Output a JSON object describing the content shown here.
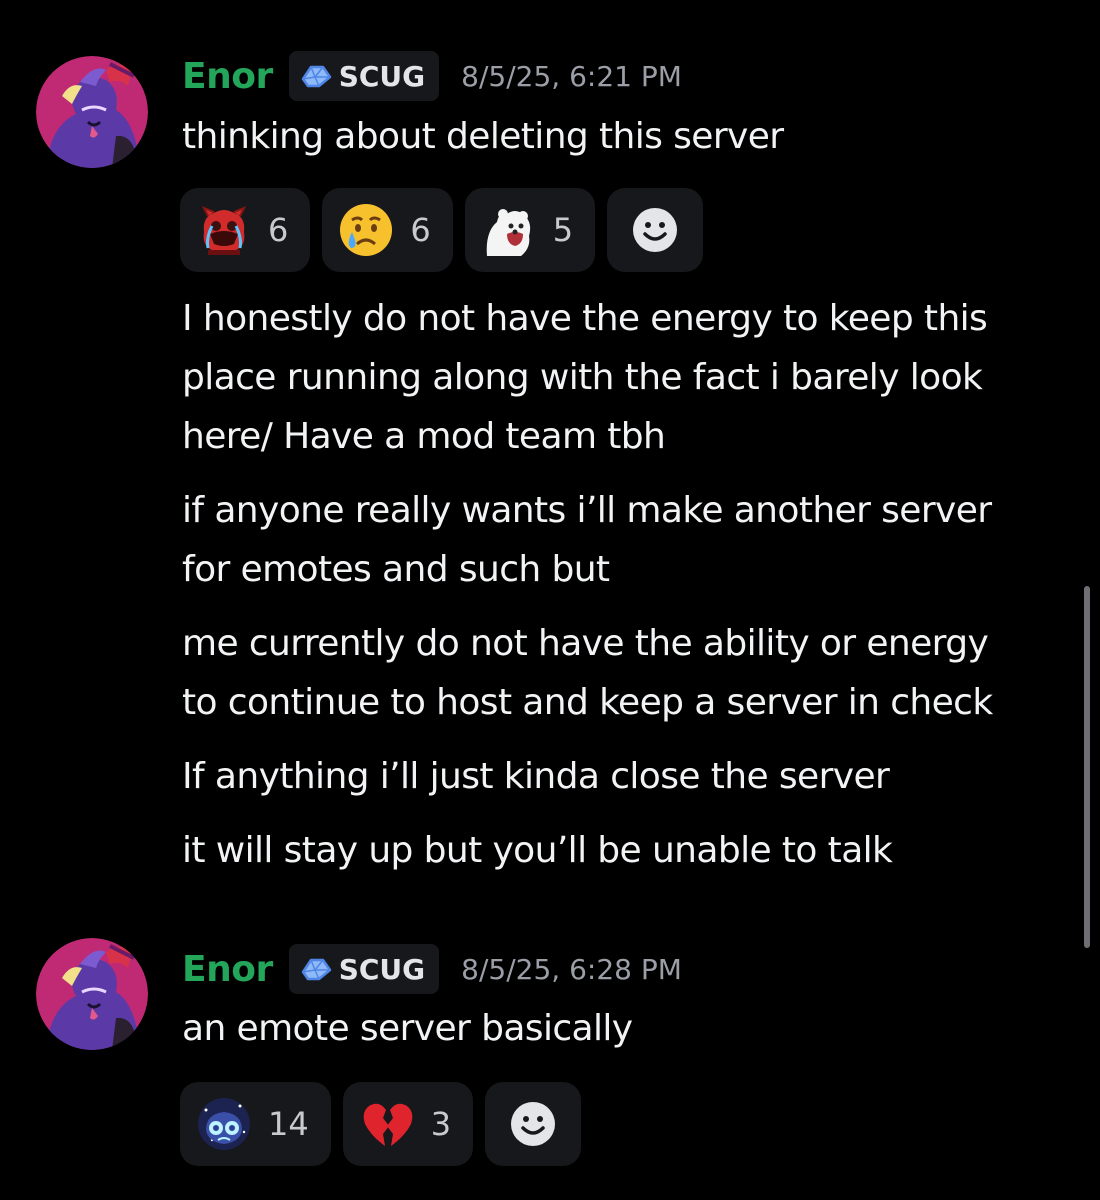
{
  "messages": [
    {
      "username": "Enor",
      "tag": "SCUG",
      "timestamp": "8/5/25, 6:21 PM",
      "lines": [
        "thinking about deleting this server"
      ],
      "reactions": [
        {
          "icon": "red-crying-creature-emoji",
          "count": "6"
        },
        {
          "icon": "crying-face-emoji",
          "count": "6"
        },
        {
          "icon": "white-bear-emoji",
          "count": "5"
        }
      ]
    },
    {
      "lines": [
        "I honestly do not have the energy to keep this",
        "place running along with the fact i barely look",
        "here/ Have a mod team tbh",
        "if anyone really wants i’ll make another server",
        "for emotes and such but",
        "me currently do not have the ability or energy",
        "to continue to host and keep a server in check",
        "If anything i’ll just kinda close the server",
        "it will stay up but you’ll be unable to talk"
      ]
    },
    {
      "username": "Enor",
      "tag": "SCUG",
      "timestamp": "8/5/25, 6:28 PM",
      "lines": [
        "an emote server basically"
      ],
      "reactions": [
        {
          "icon": "starry-crying-emoji",
          "count": "14"
        },
        {
          "icon": "broken-heart-emoji",
          "count": "3"
        }
      ]
    }
  ],
  "colors": {
    "background": "#000000",
    "username": "#23a55a",
    "text": "#f2f3f5",
    "timestamp": "#9b9ea6",
    "pill": "#17181b"
  }
}
